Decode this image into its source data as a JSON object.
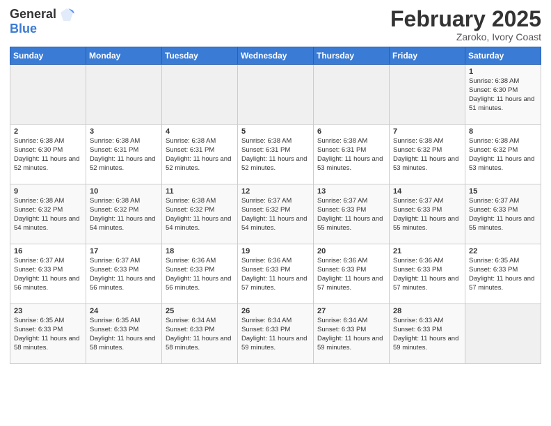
{
  "logo": {
    "general": "General",
    "blue": "Blue"
  },
  "title": "February 2025",
  "subtitle": "Zaroko, Ivory Coast",
  "days_of_week": [
    "Sunday",
    "Monday",
    "Tuesday",
    "Wednesday",
    "Thursday",
    "Friday",
    "Saturday"
  ],
  "weeks": [
    [
      {
        "day": "",
        "info": ""
      },
      {
        "day": "",
        "info": ""
      },
      {
        "day": "",
        "info": ""
      },
      {
        "day": "",
        "info": ""
      },
      {
        "day": "",
        "info": ""
      },
      {
        "day": "",
        "info": ""
      },
      {
        "day": "1",
        "info": "Sunrise: 6:38 AM\nSunset: 6:30 PM\nDaylight: 11 hours and 51 minutes."
      }
    ],
    [
      {
        "day": "2",
        "info": "Sunrise: 6:38 AM\nSunset: 6:30 PM\nDaylight: 11 hours and 52 minutes."
      },
      {
        "day": "3",
        "info": "Sunrise: 6:38 AM\nSunset: 6:31 PM\nDaylight: 11 hours and 52 minutes."
      },
      {
        "day": "4",
        "info": "Sunrise: 6:38 AM\nSunset: 6:31 PM\nDaylight: 11 hours and 52 minutes."
      },
      {
        "day": "5",
        "info": "Sunrise: 6:38 AM\nSunset: 6:31 PM\nDaylight: 11 hours and 52 minutes."
      },
      {
        "day": "6",
        "info": "Sunrise: 6:38 AM\nSunset: 6:31 PM\nDaylight: 11 hours and 53 minutes."
      },
      {
        "day": "7",
        "info": "Sunrise: 6:38 AM\nSunset: 6:32 PM\nDaylight: 11 hours and 53 minutes."
      },
      {
        "day": "8",
        "info": "Sunrise: 6:38 AM\nSunset: 6:32 PM\nDaylight: 11 hours and 53 minutes."
      }
    ],
    [
      {
        "day": "9",
        "info": "Sunrise: 6:38 AM\nSunset: 6:32 PM\nDaylight: 11 hours and 54 minutes."
      },
      {
        "day": "10",
        "info": "Sunrise: 6:38 AM\nSunset: 6:32 PM\nDaylight: 11 hours and 54 minutes."
      },
      {
        "day": "11",
        "info": "Sunrise: 6:38 AM\nSunset: 6:32 PM\nDaylight: 11 hours and 54 minutes."
      },
      {
        "day": "12",
        "info": "Sunrise: 6:37 AM\nSunset: 6:32 PM\nDaylight: 11 hours and 54 minutes."
      },
      {
        "day": "13",
        "info": "Sunrise: 6:37 AM\nSunset: 6:33 PM\nDaylight: 11 hours and 55 minutes."
      },
      {
        "day": "14",
        "info": "Sunrise: 6:37 AM\nSunset: 6:33 PM\nDaylight: 11 hours and 55 minutes."
      },
      {
        "day": "15",
        "info": "Sunrise: 6:37 AM\nSunset: 6:33 PM\nDaylight: 11 hours and 55 minutes."
      }
    ],
    [
      {
        "day": "16",
        "info": "Sunrise: 6:37 AM\nSunset: 6:33 PM\nDaylight: 11 hours and 56 minutes."
      },
      {
        "day": "17",
        "info": "Sunrise: 6:37 AM\nSunset: 6:33 PM\nDaylight: 11 hours and 56 minutes."
      },
      {
        "day": "18",
        "info": "Sunrise: 6:36 AM\nSunset: 6:33 PM\nDaylight: 11 hours and 56 minutes."
      },
      {
        "day": "19",
        "info": "Sunrise: 6:36 AM\nSunset: 6:33 PM\nDaylight: 11 hours and 57 minutes."
      },
      {
        "day": "20",
        "info": "Sunrise: 6:36 AM\nSunset: 6:33 PM\nDaylight: 11 hours and 57 minutes."
      },
      {
        "day": "21",
        "info": "Sunrise: 6:36 AM\nSunset: 6:33 PM\nDaylight: 11 hours and 57 minutes."
      },
      {
        "day": "22",
        "info": "Sunrise: 6:35 AM\nSunset: 6:33 PM\nDaylight: 11 hours and 57 minutes."
      }
    ],
    [
      {
        "day": "23",
        "info": "Sunrise: 6:35 AM\nSunset: 6:33 PM\nDaylight: 11 hours and 58 minutes."
      },
      {
        "day": "24",
        "info": "Sunrise: 6:35 AM\nSunset: 6:33 PM\nDaylight: 11 hours and 58 minutes."
      },
      {
        "day": "25",
        "info": "Sunrise: 6:34 AM\nSunset: 6:33 PM\nDaylight: 11 hours and 58 minutes."
      },
      {
        "day": "26",
        "info": "Sunrise: 6:34 AM\nSunset: 6:33 PM\nDaylight: 11 hours and 59 minutes."
      },
      {
        "day": "27",
        "info": "Sunrise: 6:34 AM\nSunset: 6:33 PM\nDaylight: 11 hours and 59 minutes."
      },
      {
        "day": "28",
        "info": "Sunrise: 6:33 AM\nSunset: 6:33 PM\nDaylight: 11 hours and 59 minutes."
      },
      {
        "day": "",
        "info": ""
      }
    ]
  ]
}
